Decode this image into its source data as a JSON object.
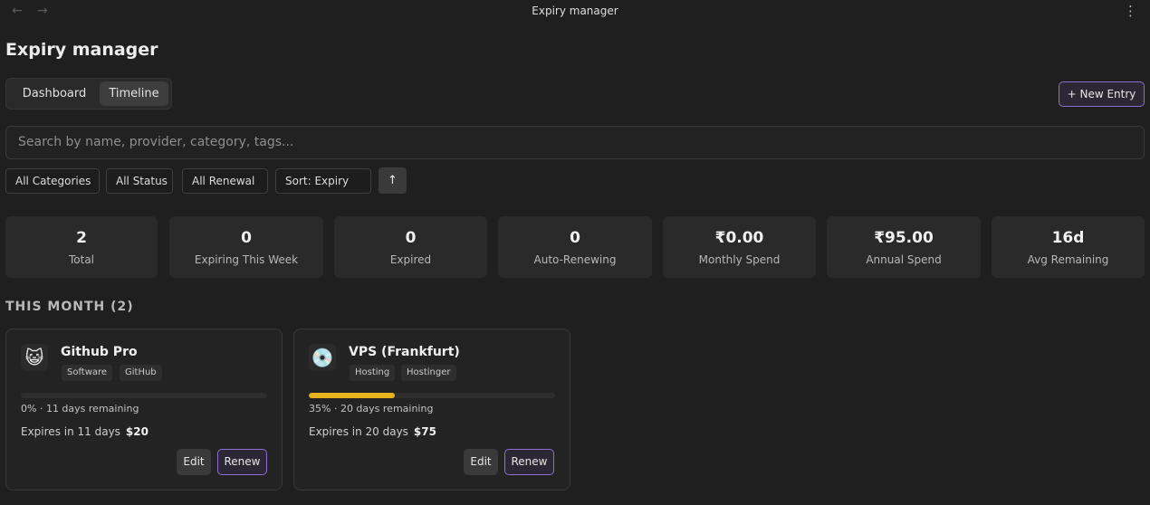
{
  "window": {
    "title": "Expiry manager",
    "back_icon": "arrow-left-icon",
    "forward_icon": "arrow-right-icon",
    "menu_icon": "kebab-menu-icon"
  },
  "page": {
    "title": "Expiry manager"
  },
  "tabs": [
    {
      "label": "Dashboard",
      "active": false
    },
    {
      "label": "Timeline",
      "active": true
    }
  ],
  "new_entry_label": "+ New Entry",
  "search": {
    "placeholder": "Search by name, provider, category, tags..."
  },
  "filters": {
    "category": "All Categories",
    "status": "All Status",
    "renewal": "All Renewal",
    "sort": "Sort: Expiry",
    "sort_direction_icon": "arrow-up-icon"
  },
  "stats": [
    {
      "value": "2",
      "label": "Total"
    },
    {
      "value": "0",
      "label": "Expiring This Week"
    },
    {
      "value": "0",
      "label": "Expired"
    },
    {
      "value": "0",
      "label": "Auto-Renewing"
    },
    {
      "value": "₹0.00",
      "label": "Monthly Spend"
    },
    {
      "value": "₹95.00",
      "label": "Annual Spend"
    },
    {
      "value": "16d",
      "label": "Avg Remaining"
    }
  ],
  "section": {
    "title": "THIS MONTH (2)"
  },
  "cards": [
    {
      "icon": "😺",
      "icon_name": "cat-face-icon",
      "name": "Github Pro",
      "tags": [
        "Software",
        "GitHub"
      ],
      "progress_percent": 0,
      "progress_text": "0% · 11 days remaining",
      "expires": "Expires in 11 days",
      "price": "$20",
      "edit_label": "Edit",
      "renew_label": "Renew"
    },
    {
      "icon": "💿",
      "icon_name": "disc-icon",
      "name": "VPS (Frankfurt)",
      "tags": [
        "Hosting",
        "Hostinger"
      ],
      "progress_percent": 35,
      "progress_text": "35% · 20 days remaining",
      "expires": "Expires in 20 days",
      "price": "$75",
      "edit_label": "Edit",
      "renew_label": "Renew"
    }
  ],
  "colors": {
    "background": "#1f1f1f",
    "accent": "#8b6fd1",
    "progress": "#e8b41d"
  }
}
